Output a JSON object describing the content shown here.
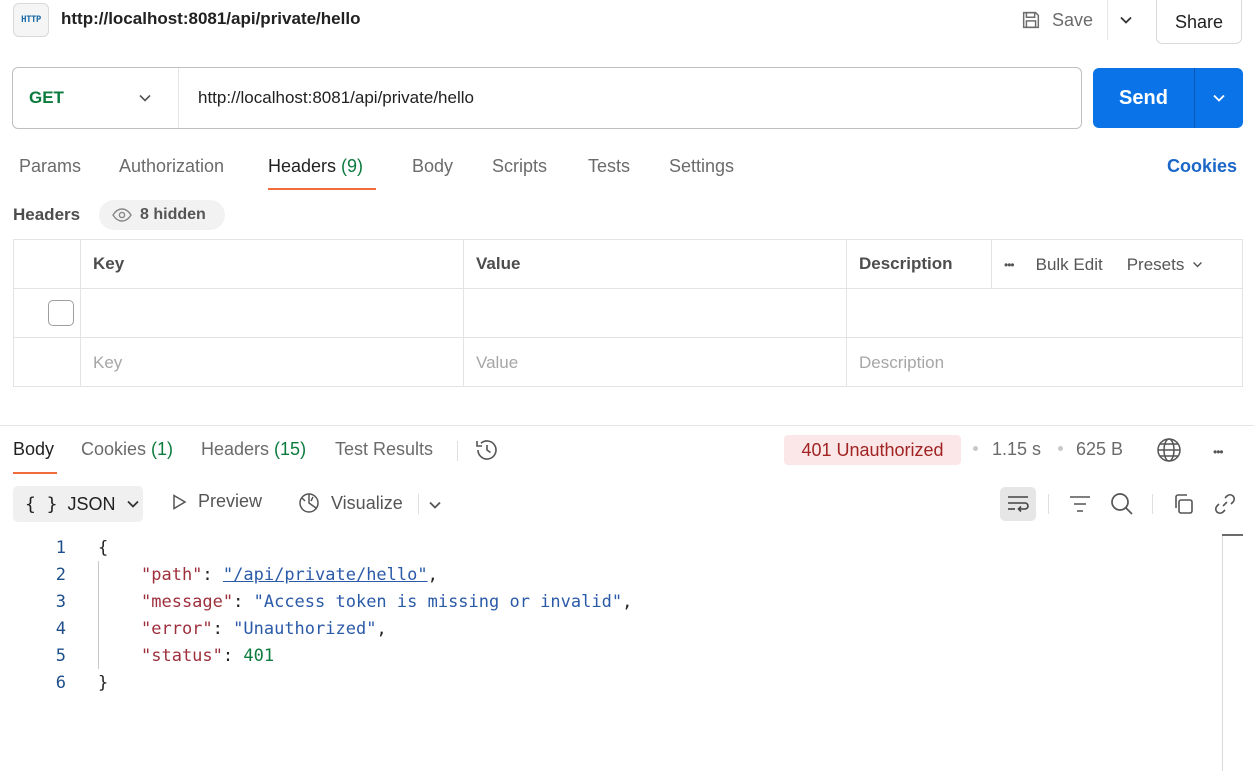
{
  "top": {
    "badge": "HTTP",
    "title": "http://localhost:8081/api/private/hello",
    "save_label": "Save",
    "share_label": "Share"
  },
  "request": {
    "method": "GET",
    "url": "http://localhost:8081/api/private/hello",
    "send_label": "Send",
    "tabs": [
      {
        "label": "Params"
      },
      {
        "label": "Authorization"
      },
      {
        "label": "Headers ",
        "count": "(9)"
      },
      {
        "label": "Body"
      },
      {
        "label": "Scripts"
      },
      {
        "label": "Tests"
      },
      {
        "label": "Settings"
      }
    ],
    "cookies_label": "Cookies"
  },
  "headers": {
    "title": "Headers",
    "hidden_label": "8 hidden",
    "columns": [
      "Key",
      "Value",
      "Description"
    ],
    "more_label": "•••",
    "bulk_edit_label": "Bulk Edit",
    "presets_label": "Presets",
    "placeholders": {
      "key": "Key",
      "value": "Value",
      "description": "Description"
    }
  },
  "response": {
    "tabs": [
      {
        "label": "Body"
      },
      {
        "label": "Cookies ",
        "count": "(1)"
      },
      {
        "label": "Headers ",
        "count": "(15)"
      },
      {
        "label": "Test Results"
      }
    ],
    "status": "401 Unauthorized",
    "time": "1.15 s",
    "size": "625 B",
    "more_label": "•••",
    "format": "JSON",
    "preview_label": "Preview",
    "visualize_label": "Visualize",
    "body_lines": [
      {
        "n": "1",
        "text": "{"
      },
      {
        "n": "2",
        "key": "\"path\"",
        "value": "\"/api/private/hello\"",
        "trail": ","
      },
      {
        "n": "3",
        "key": "\"message\"",
        "value": "\"Access token is missing or invalid\"",
        "trail": ","
      },
      {
        "n": "4",
        "key": "\"error\"",
        "value": "\"Unauthorized\"",
        "trail": ","
      },
      {
        "n": "5",
        "key": "\"status\"",
        "value": "401",
        "trail": ""
      },
      {
        "n": "6",
        "text": "}"
      }
    ]
  },
  "colors": {
    "accent": "#0a73e8",
    "tab_indicator": "#f26b3a",
    "method_get": "#0b7b3e",
    "error_status": "#a12323"
  }
}
